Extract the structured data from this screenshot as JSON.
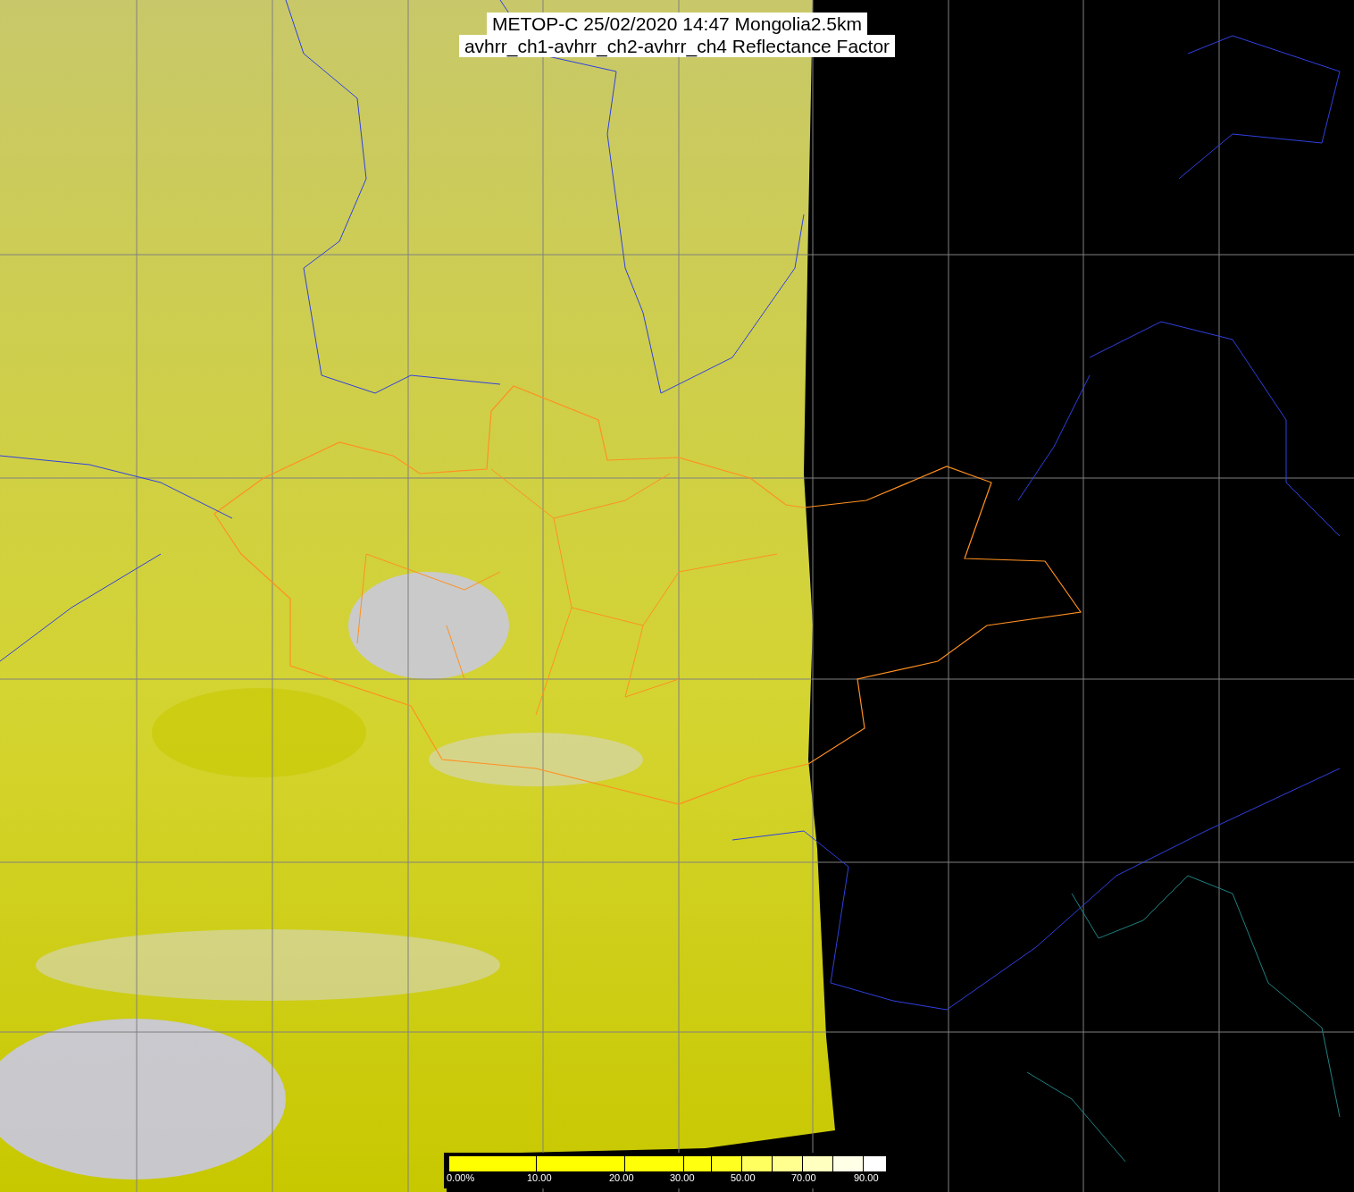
{
  "title_lines": [
    "METOP-C 25/02/2020 14:47 Mongolia2.5km",
    "avhrr_ch1-avhrr_ch2-avhrr_ch4 Reflectance Factor"
  ],
  "color_scale": {
    "labels": [
      "0.00%",
      "10.00",
      "20.00",
      "30.00",
      "50.00",
      "70.00",
      "90.00"
    ]
  }
}
